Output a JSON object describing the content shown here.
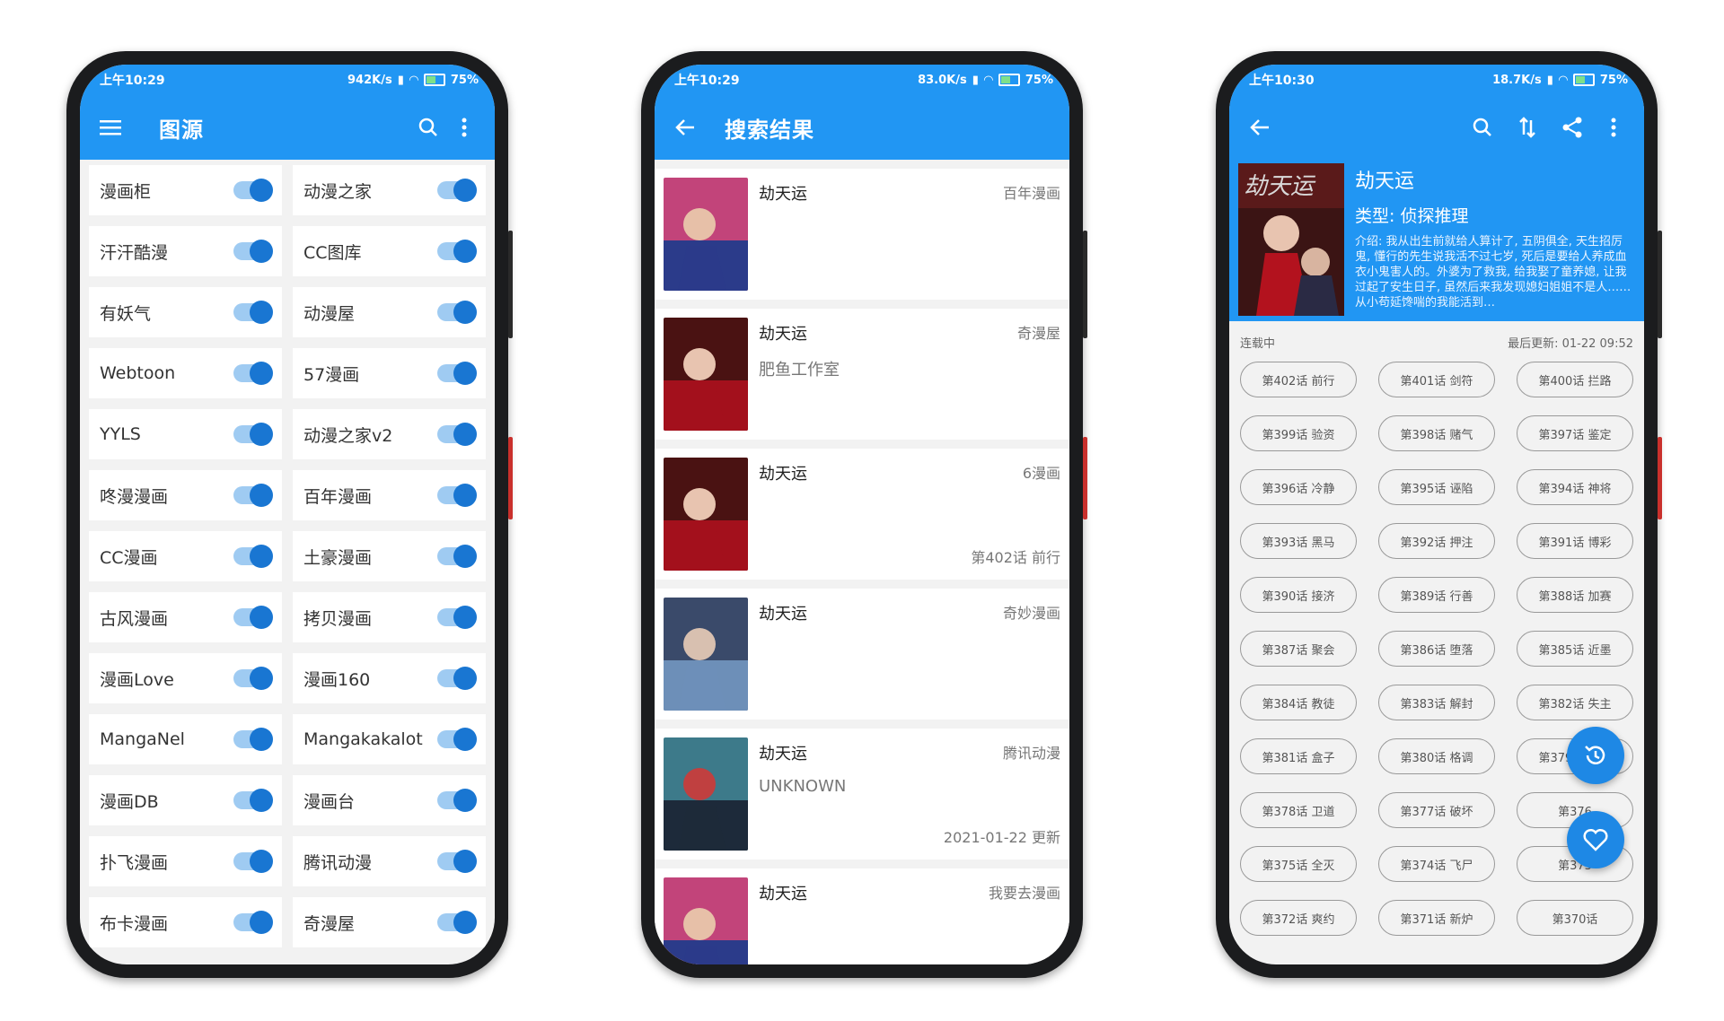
{
  "accent": "#2196f3",
  "phone1": {
    "status": {
      "time": "上午10:29",
      "speed": "942K/s",
      "battery": "75%"
    },
    "toolbar": {
      "title": "图源",
      "menu_icon": "menu-icon",
      "search_icon": "search-icon",
      "more_icon": "more-icon"
    },
    "sources": [
      {
        "name": "漫画柜",
        "enabled": true
      },
      {
        "name": "动漫之家",
        "enabled": true
      },
      {
        "name": "汗汗酷漫",
        "enabled": true
      },
      {
        "name": "CC图库",
        "enabled": true
      },
      {
        "name": "有妖气",
        "enabled": true
      },
      {
        "name": "动漫屋",
        "enabled": true
      },
      {
        "name": "Webtoon",
        "enabled": true
      },
      {
        "name": "57漫画",
        "enabled": true
      },
      {
        "name": "YYLS",
        "enabled": true
      },
      {
        "name": "动漫之家v2",
        "enabled": true
      },
      {
        "name": "咚漫漫画",
        "enabled": true
      },
      {
        "name": "百年漫画",
        "enabled": true
      },
      {
        "name": "CC漫画",
        "enabled": true
      },
      {
        "name": "土豪漫画",
        "enabled": true
      },
      {
        "name": "古风漫画",
        "enabled": true
      },
      {
        "name": "拷贝漫画",
        "enabled": true
      },
      {
        "name": "漫画Love",
        "enabled": true
      },
      {
        "name": "漫画160",
        "enabled": true
      },
      {
        "name": "MangaNel",
        "enabled": true
      },
      {
        "name": "Mangakakalot",
        "enabled": true
      },
      {
        "name": "漫画DB",
        "enabled": true
      },
      {
        "name": "漫画台",
        "enabled": true
      },
      {
        "name": "扑飞漫画",
        "enabled": true
      },
      {
        "name": "腾讯动漫",
        "enabled": true
      },
      {
        "name": "布卡漫画",
        "enabled": true
      },
      {
        "name": "奇漫屋",
        "enabled": true
      }
    ]
  },
  "phone2": {
    "status": {
      "time": "上午10:29",
      "speed": "83.0K/s",
      "battery": "75%"
    },
    "toolbar": {
      "title": "搜索结果"
    },
    "results": [
      {
        "title": "劫天运",
        "source": "百年漫画",
        "author": "",
        "extra": ""
      },
      {
        "title": "劫天运",
        "source": "奇漫屋",
        "author": "肥鱼工作室",
        "extra": ""
      },
      {
        "title": "劫天运",
        "source": "6漫画",
        "author": "",
        "extra": "第402话 前行"
      },
      {
        "title": "劫天运",
        "source": "奇妙漫画",
        "author": "",
        "extra": ""
      },
      {
        "title": "劫天运",
        "source": "腾讯动漫",
        "author": "UNKNOWN",
        "extra": "2021-01-22 更新"
      },
      {
        "title": "劫天运",
        "source": "我要去漫画",
        "author": "",
        "extra": ""
      }
    ]
  },
  "phone3": {
    "status": {
      "time": "上午10:30",
      "speed": "18.7K/s",
      "battery": "75%"
    },
    "detail": {
      "title": "劫天运",
      "type": "类型: 侦探推理",
      "intro": "介绍: 我从出生前就给人算计了, 五阴俱全, 天生招厉鬼, 懂行的先生说我活不过七岁, 死后是要给人养成血衣小鬼害人的。外婆为了救我, 给我娶了童养媳, 让我过起了安生日子, 虽然后来我发现媳妇姐姐不是人…… 从小苟延馋喘的我能活到…",
      "status_text": "连载中",
      "last_update": "最后更新: 01-22 09:52"
    },
    "chapters": [
      "第402话 前行",
      "第401话 剑符",
      "第400话 拦路",
      "第399话 验资",
      "第398话 赌气",
      "第397话 鉴定",
      "第396话 冷静",
      "第395话 诬陷",
      "第394话 神将",
      "第393话 黑马",
      "第392话 押注",
      "第391话 博彩",
      "第390话 接济",
      "第389话 行善",
      "第388话 加赛",
      "第387话 聚会",
      "第386话 堕落",
      "第385话 近墨",
      "第384话 教徒",
      "第383话 解封",
      "第382话 失主",
      "第381话 盒子",
      "第380话 格调",
      "第379话 郎君",
      "第378话 卫道",
      "第377话 破坏",
      "第376",
      "第375话 全灭",
      "第374话 飞尸",
      "第373",
      "第372话 爽约",
      "第371话 新炉",
      "第370话"
    ]
  }
}
